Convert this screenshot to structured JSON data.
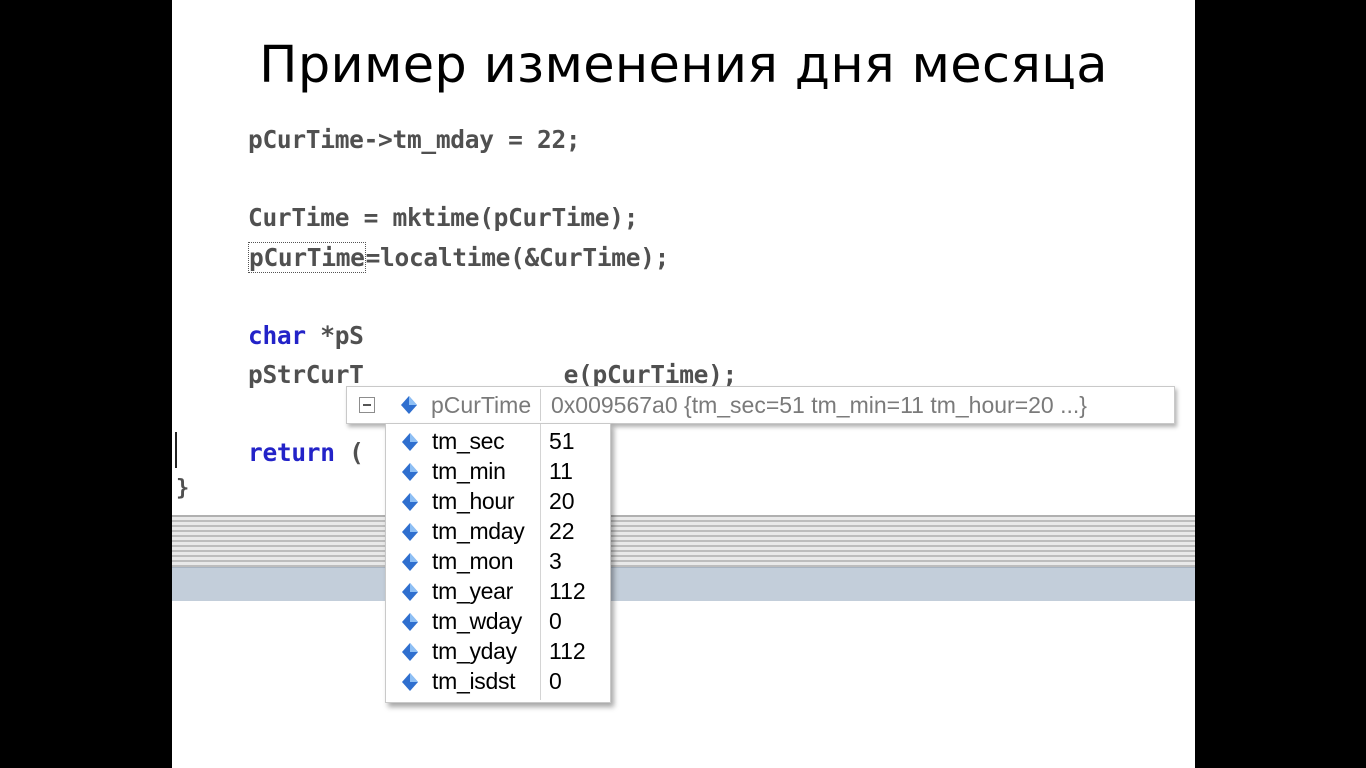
{
  "slide": {
    "title": "Пример изменения дня месяца"
  },
  "code": {
    "line1": "pCurTime->tm_mday = 22;",
    "line2": "CurTime = mktime(pCurTime);",
    "line3_var": "pCurTime",
    "line3_rest": "=localtime(&CurTime);",
    "line4_kw": "char",
    "line4_rest": " *pS",
    "line5_pre": "pStrCurT",
    "line5_rest": "e(pCurTime);",
    "line6_kw": "return",
    "line6_rest": " (",
    "closing_brace": "}"
  },
  "datatip": {
    "expand_icon": "minus-box-icon",
    "variable_icon": "field-diamond-icon",
    "name": "pCurTime",
    "value": "0x009567a0 {tm_sec=51 tm_min=11 tm_hour=20 ...}",
    "members": [
      {
        "name": "tm_sec",
        "value": "51"
      },
      {
        "name": "tm_min",
        "value": "11"
      },
      {
        "name": "tm_hour",
        "value": "20"
      },
      {
        "name": "tm_mday",
        "value": "22"
      },
      {
        "name": "tm_mon",
        "value": "3"
      },
      {
        "name": "tm_year",
        "value": "112"
      },
      {
        "name": "tm_wday",
        "value": "0"
      },
      {
        "name": "tm_yday",
        "value": "112"
      },
      {
        "name": "tm_isdst",
        "value": "0"
      }
    ]
  },
  "colors": {
    "keyword": "#2323c8",
    "code": "#505050",
    "status_bar": "#c3ceda"
  }
}
